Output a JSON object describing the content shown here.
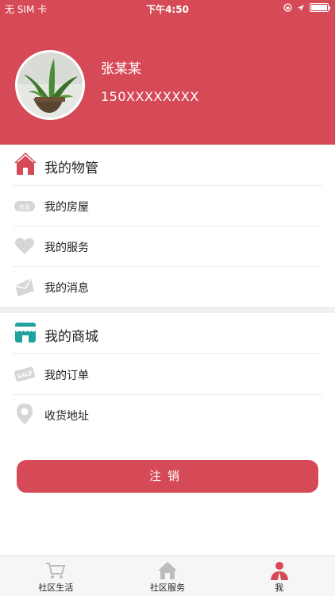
{
  "status_bar": {
    "carrier": "无 SIM 卡",
    "time": "下午4:50"
  },
  "profile": {
    "name": "张某某",
    "phone": "150XXXXXXXX",
    "avatar_icon": "plant-photo-avatar"
  },
  "property": {
    "title": "我的物管",
    "title_icon": "house-icon",
    "items": [
      {
        "label": "我的房屋",
        "icon": "house-tag-icon"
      },
      {
        "label": "我的服务",
        "icon": "heart-icon"
      },
      {
        "label": "我的消息",
        "icon": "envelope-icon"
      }
    ]
  },
  "mall": {
    "title": "我的商城",
    "title_icon": "store-icon",
    "items": [
      {
        "label": "我的订单",
        "icon": "sale-tag-icon"
      },
      {
        "label": "收货地址",
        "icon": "location-pin-icon"
      }
    ]
  },
  "logout_label": "注销",
  "tabbar": {
    "tabs": [
      {
        "label": "社区生活",
        "icon": "cart-icon"
      },
      {
        "label": "社区服务",
        "icon": "house-icon"
      },
      {
        "label": "我",
        "icon": "person-icon",
        "active": true
      }
    ]
  },
  "colors": {
    "brand": "#d64a57",
    "mall_icon": "#1fa3a0",
    "gray_icon": "#c8c8c8"
  }
}
